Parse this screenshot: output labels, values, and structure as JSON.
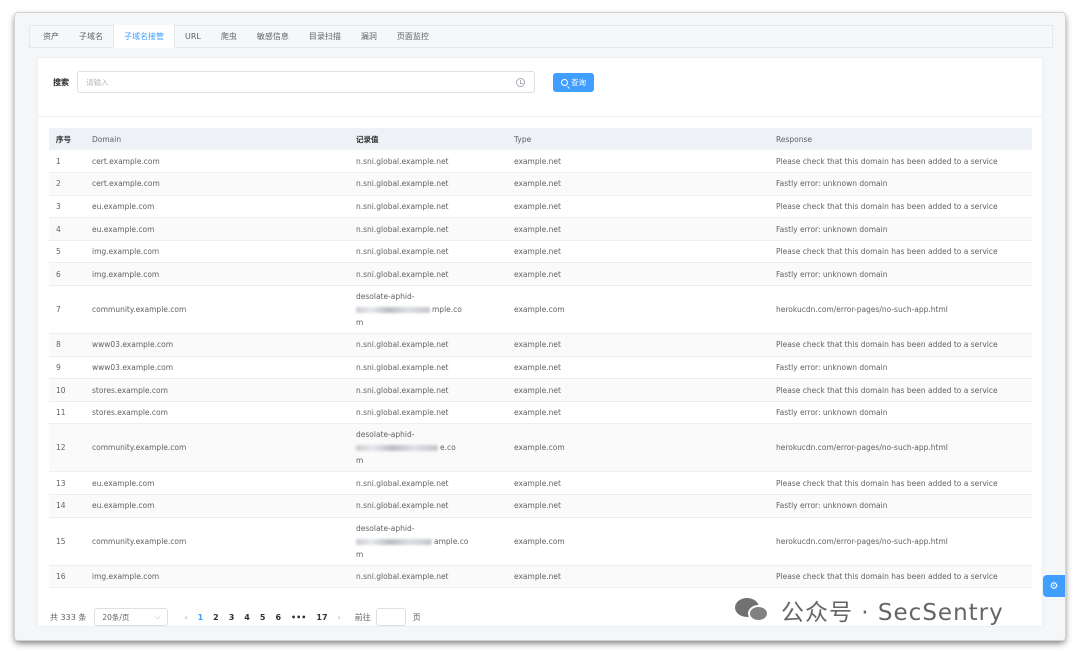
{
  "tabs": [
    "资产",
    "子域名",
    "子域名接管",
    "URL",
    "爬虫",
    "敏感信息",
    "目录扫描",
    "漏洞",
    "页面监控"
  ],
  "active_tab": "子域名接管",
  "search": {
    "label": "搜索",
    "placeholder": "请输入",
    "button_label": "查询"
  },
  "table": {
    "columns": [
      "序号",
      "Domain",
      "记录值",
      "Type",
      "Response"
    ],
    "rows": [
      {
        "no": "1",
        "domain": "cert.example.com",
        "record": "n.sni.global.example.net",
        "type": "example.net",
        "response": "Please check that this domain has been added to a service"
      },
      {
        "no": "2",
        "domain": "cert.example.com",
        "record": "n.sni.global.example.net",
        "type": "example.net",
        "response": "Fastly error: unknown domain"
      },
      {
        "no": "3",
        "domain": "eu.example.com",
        "record": "n.sni.global.example.net",
        "type": "example.net",
        "response": "Please check that this domain has been added to a service"
      },
      {
        "no": "4",
        "domain": "eu.example.com",
        "record": "n.sni.global.example.net",
        "type": "example.net",
        "response": "Fastly error: unknown domain"
      },
      {
        "no": "5",
        "domain": "img.example.com",
        "record": "n.sni.global.example.net",
        "type": "example.net",
        "response": "Please check that this domain has been added to a service"
      },
      {
        "no": "6",
        "domain": "img.example.com",
        "record": "n.sni.global.example.net",
        "type": "example.net",
        "response": "Fastly error: unknown domain"
      },
      {
        "no": "7",
        "domain": "community.example.com",
        "record_l1": "desolate-aphid-",
        "record_l2": "mple.co",
        "record_l3": "m",
        "type": "example.com",
        "response": "herokucdn.com/error-pages/no-such-app.html"
      },
      {
        "no": "8",
        "domain": "www03.example.com",
        "record": "n.sni.global.example.net",
        "type": "example.net",
        "response": "Please check that this domain has been added to a service"
      },
      {
        "no": "9",
        "domain": "www03.example.com",
        "record": "n.sni.global.example.net",
        "type": "example.net",
        "response": "Fastly error: unknown domain"
      },
      {
        "no": "10",
        "domain": "stores.example.com",
        "record": "n.sni.global.example.net",
        "type": "example.net",
        "response": "Please check that this domain has been added to a service"
      },
      {
        "no": "11",
        "domain": "stores.example.com",
        "record": "n.sni.global.example.net",
        "type": "example.net",
        "response": "Fastly error: unknown domain"
      },
      {
        "no": "12",
        "domain": "community.example.com",
        "record_l1": "desolate-aphid-",
        "record_l2": "e.co",
        "record_l3": "m",
        "type": "example.com",
        "response": "herokucdn.com/error-pages/no-such-app.html"
      },
      {
        "no": "13",
        "domain": "eu.example.com",
        "record": "n.sni.global.example.net",
        "type": "example.net",
        "response": "Please check that this domain has been added to a service"
      },
      {
        "no": "14",
        "domain": "eu.example.com",
        "record": "n.sni.global.example.net",
        "type": "example.net",
        "response": "Fastly error: unknown domain"
      },
      {
        "no": "15",
        "domain": "community.example.com",
        "record_l1": "desolate-aphid-",
        "record_l2": "ample.co",
        "record_l3": "m",
        "type": "example.com",
        "response": "herokucdn.com/error-pages/no-such-app.html"
      },
      {
        "no": "16",
        "domain": "img.example.com",
        "record": "n.sni.global.example.net",
        "type": "example.net",
        "response": "Please check that this domain has been added to a service"
      }
    ]
  },
  "pagination": {
    "total": "共 333 条",
    "page_size": "20条/页",
    "prev": "‹",
    "pages": [
      "1",
      "2",
      "3",
      "4",
      "5",
      "6",
      "•••",
      "17"
    ],
    "current": "1",
    "next": "›",
    "jump_label": "前往",
    "page_unit": "页"
  },
  "watermark": "公众号 · SecSentry",
  "icons": {
    "settings": "gear-icon",
    "wechat": "wechat-icon",
    "search": "search-icon",
    "history": "clock-icon"
  },
  "colors": {
    "primary": "#409eff",
    "header_bg": "#eef1f6",
    "text": "#606266"
  }
}
